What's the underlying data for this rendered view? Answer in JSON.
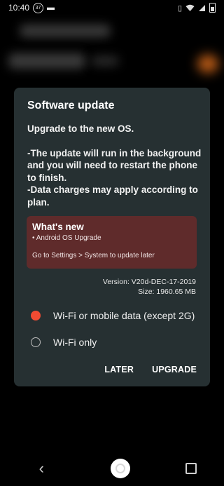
{
  "status_bar": {
    "time": "10:40",
    "badge": "37",
    "icons": [
      "vibrate-icon",
      "wifi-icon",
      "signal-icon",
      "battery-icon"
    ]
  },
  "dialog": {
    "title": "Software update",
    "headline": "Upgrade to the new OS.",
    "note1": "-The update will run in the background and you will need to restart the phone to finish.",
    "note2": "-Data charges may apply according to plan.",
    "whats_new": {
      "title": "What's new",
      "item": "• Android OS Upgrade",
      "link": "Go to Settings > System to update later"
    },
    "version": "Version: V20d-DEC-17-2019",
    "size": "Size: 1960.65 MB",
    "options": [
      {
        "label": "Wi-Fi or mobile data (except 2G)",
        "selected": true
      },
      {
        "label": "Wi-Fi only",
        "selected": false
      }
    ],
    "buttons": {
      "later": "LATER",
      "upgrade": "UPGRADE"
    }
  },
  "colors": {
    "dialog_bg": "#263032",
    "whats_new_bg": "#5f2b2b",
    "radio_selected": "#f24b32"
  },
  "nav": {
    "icons": [
      "back-icon",
      "home-icon",
      "recents-icon"
    ]
  }
}
